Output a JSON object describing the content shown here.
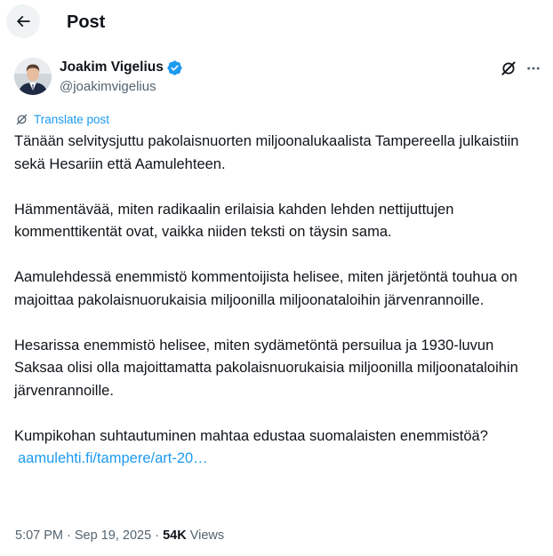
{
  "header": {
    "title": "Post",
    "back_icon": "arrow-left-icon"
  },
  "author": {
    "name": "Joakim Vigelius",
    "handle": "@joakimvigelius",
    "verified": true,
    "verified_color": "#1d9bf0"
  },
  "actions": {
    "grok_icon": "grok-icon",
    "more_icon": "more-horizontal-icon"
  },
  "translate": {
    "label": "Translate post",
    "color": "#1d9bf0"
  },
  "post": {
    "paragraphs": [
      "Tänään selvitysjuttu pakolaisnuorten miljoonalukaalista Tampereella julkaistiin sekä Hesariin että Aamulehteen.",
      "Hämmentävää, miten radikaalin erilaisia kahden lehden nettijuttujen kommenttikentät ovat, vaikka niiden teksti on täysin sama.",
      "Aamulehdessä enemmistö kommentoijista helisee, miten järjetöntä touhua on majoittaa pakolaisnuorukaisia miljoonilla miljoonataloihin järvenrannoille.",
      "Hesarissa enemmistö helisee, miten sydämetöntä persuilua ja 1930-luvun Saksaa olisi olla majoittamatta pakolaisnuorukaisia miljoonilla miljoonataloihin järvenrannoille.",
      "Kumpikohan suhtautuminen mahtaa edustaa suomalaisten enemmistöä?"
    ],
    "link_text": "aamulehti.fi/tampere/art-20…"
  },
  "meta": {
    "time": "5:07 PM",
    "separator": " · ",
    "date": "Sep 19, 2025",
    "views_count": "54K",
    "views_label": " Views"
  }
}
